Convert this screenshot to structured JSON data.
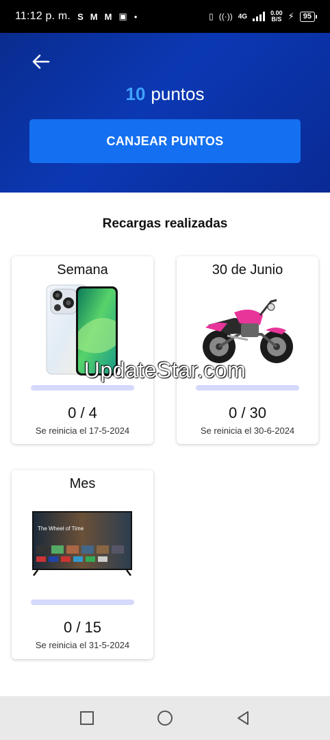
{
  "status_bar": {
    "time": "11:12 p. m.",
    "notification_icons": [
      "S",
      "M",
      "M"
    ],
    "network": "4G",
    "speed_value": "0.00",
    "speed_unit": "B/S",
    "battery": "95"
  },
  "header": {
    "points_value": "10",
    "points_label": "puntos",
    "redeem_label": "CANJEAR PUNTOS",
    "background_color": "#0b38b3",
    "accent_color": "#3fa3ff"
  },
  "section_title": "Recargas realizadas",
  "cards": [
    {
      "title": "Semana",
      "image": "smartphone-image",
      "progress": 0,
      "count": "0 / 4",
      "reset": "Se reinicia el 17-5-2024"
    },
    {
      "title": "30 de Junio",
      "image": "motorcycle-image",
      "progress": 0,
      "count": "0 / 30",
      "reset": "Se reinicia el 30-6-2024"
    },
    {
      "title": "Mes",
      "image": "smart-tv-image",
      "progress": 0,
      "count": "0 / 15",
      "reset": "Se reinicia el 31-5-2024"
    }
  ],
  "tv_screen": {
    "show_title": "The Wheel of Time"
  },
  "watermark": "UpdateStar.com",
  "nav": {
    "icons": [
      "recents-square-icon",
      "home-circle-icon",
      "back-triangle-icon"
    ]
  }
}
